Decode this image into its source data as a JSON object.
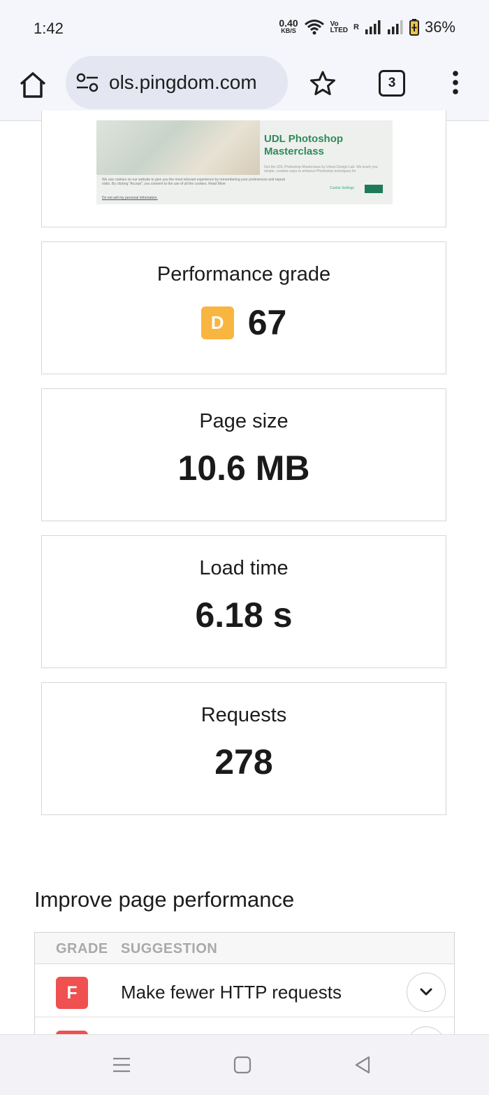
{
  "status_bar": {
    "time": "1:42",
    "net_speed": "0.40",
    "net_unit": "KB/S",
    "volte_top": "Vo",
    "volte_bottom": "LTED",
    "roaming": "R",
    "battery": "36%"
  },
  "browser": {
    "url": "ols.pingdom.com",
    "tab_count": "3"
  },
  "screenshot_preview": {
    "title": "UDL Photoshop Masterclass",
    "subtitle": "Get the UDL Photoshop Masterclass by Urban Design Lab. We teach you simple, creative ways to enhance Photoshop techniques for",
    "cookie_text": "We use cookies on our website to give you the most relevant experience by remembering your preferences and repeat visits. By clicking \"Accept\", you consent to the use of all the cookies. Read More",
    "do_not_sell": "Do not sell my personal information.",
    "cookie_settings": "Cookie Settings"
  },
  "metrics": {
    "performance": {
      "label": "Performance grade",
      "grade": "D",
      "score": "67",
      "grade_color": "#f8b540"
    },
    "page_size": {
      "label": "Page size",
      "value": "10.6 MB"
    },
    "load_time": {
      "label": "Load time",
      "value": "6.18 s"
    },
    "requests": {
      "label": "Requests",
      "value": "278"
    }
  },
  "improve": {
    "title": "Improve page performance",
    "headers": {
      "grade": "GRADE",
      "suggestion": "SUGGESTION"
    },
    "rows": [
      {
        "grade": "F",
        "suggestion": "Make fewer HTTP requests",
        "grade_color": "#f0504f"
      },
      {
        "grade": "",
        "suggestion": "",
        "grade_color": "#f0504f"
      }
    ]
  }
}
